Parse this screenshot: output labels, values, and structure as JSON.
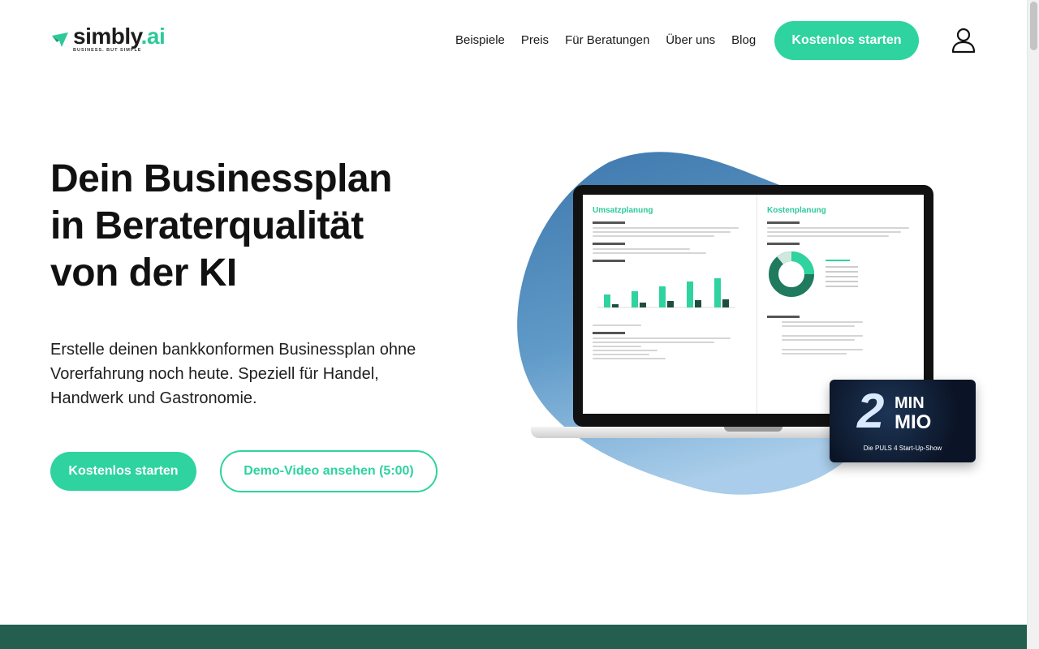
{
  "header": {
    "logo_name": "simbly",
    "logo_suffix": ".ai",
    "logo_tagline": "BUSINESS. BUT SIMPLE",
    "nav": [
      "Beispiele",
      "Preis",
      "Für Beratungen",
      "Über uns",
      "Blog"
    ],
    "cta_label": "Kostenlos starten",
    "user_icon": "user-icon"
  },
  "hero": {
    "title_line1": "Dein Businessplan",
    "title_line2": "in Beraterqualität",
    "title_line3": "von der KI",
    "subtitle": "Erstelle deinen bankkonformen Businessplan ohne Vorerfahrung noch heute. Speziell für Handel, Handwerk und Gastronomie.",
    "primary_button": "Kostenlos starten",
    "secondary_button": "Demo-Video ansehen (5:00)"
  },
  "illustration": {
    "left_heading": "Umsatzplanung",
    "right_heading": "Kostenplanung",
    "badge_number": "2",
    "badge_min": "MIN",
    "badge_mio": "MIO",
    "badge_subtitle": "Die PULS 4 Start-Up-Show"
  },
  "colors": {
    "accent": "#2ed39f",
    "blob": "#4a86b8",
    "band": "#235e4f"
  }
}
